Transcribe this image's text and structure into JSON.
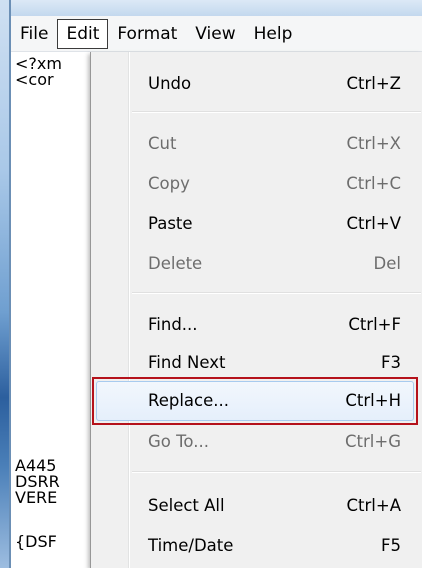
{
  "menubar": {
    "items": [
      {
        "label": "File"
      },
      {
        "label": "Edit"
      },
      {
        "label": "Format"
      },
      {
        "label": "View"
      },
      {
        "label": "Help"
      }
    ],
    "active": "Edit"
  },
  "editor": {
    "lines_top": [
      "<?xm",
      "<cor"
    ],
    "lines_bottom": [
      "A445",
      "DSRR",
      "VERE",
      "{DSF"
    ]
  },
  "edit_menu": {
    "items": [
      {
        "label": "Undo",
        "shortcut": "Ctrl+Z",
        "enabled": true
      },
      {
        "label": "Cut",
        "shortcut": "Ctrl+X",
        "enabled": false
      },
      {
        "label": "Copy",
        "shortcut": "Ctrl+C",
        "enabled": false
      },
      {
        "label": "Paste",
        "shortcut": "Ctrl+V",
        "enabled": true
      },
      {
        "label": "Delete",
        "shortcut": "Del",
        "enabled": false
      },
      {
        "label": "Find...",
        "shortcut": "Ctrl+F",
        "enabled": true
      },
      {
        "label": "Find Next",
        "shortcut": "F3",
        "enabled": true
      },
      {
        "label": "Replace...",
        "shortcut": "Ctrl+H",
        "enabled": true
      },
      {
        "label": "Go To...",
        "shortcut": "Ctrl+G",
        "enabled": false
      },
      {
        "label": "Select All",
        "shortcut": "Ctrl+A",
        "enabled": true
      },
      {
        "label": "Time/Date",
        "shortcut": "F5",
        "enabled": true
      }
    ],
    "highlighted": "Replace..."
  },
  "colors": {
    "highlight_border": "#b5121b",
    "menu_background": "#f0f0f0",
    "disabled_text": "#6d6d6d"
  }
}
